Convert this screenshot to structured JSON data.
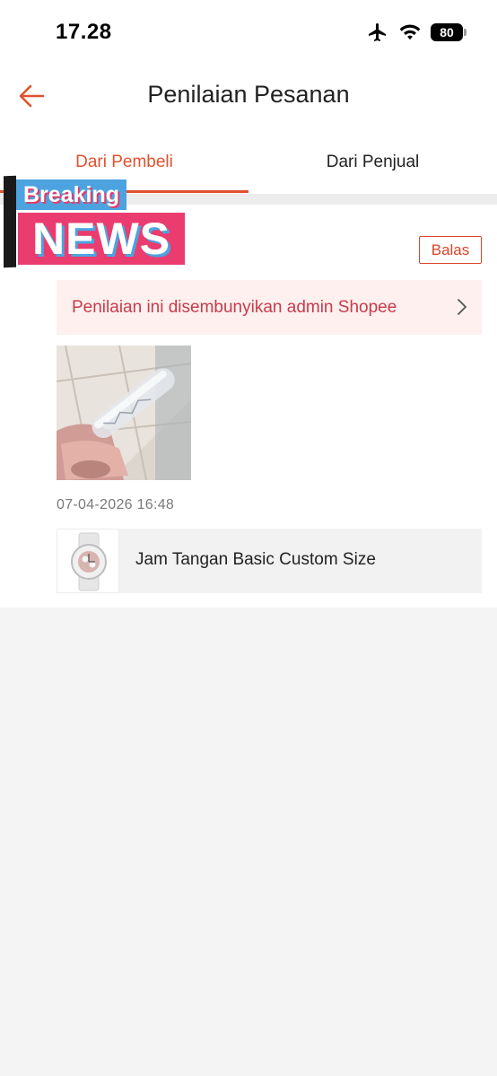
{
  "status_bar": {
    "time": "17.28",
    "battery": "80"
  },
  "header": {
    "title": "Penilaian Pesanan"
  },
  "tabs": [
    {
      "label": "Dari Pembeli",
      "active": true
    },
    {
      "label": "Dari Penjual",
      "active": false
    }
  ],
  "overlay": {
    "breaking": "Breaking",
    "news": "NEWS"
  },
  "review": {
    "reply_label": "Balas",
    "hidden_notice": "Penilaian ini disembunyikan admin Shopee",
    "date": "07-04-2026 16:48"
  },
  "product": {
    "name": "Jam Tangan Basic Custom Size"
  },
  "colors": {
    "accent": "#e0522e",
    "notice_text": "#c73b4c",
    "notice_bg": "#fdf0ee"
  }
}
